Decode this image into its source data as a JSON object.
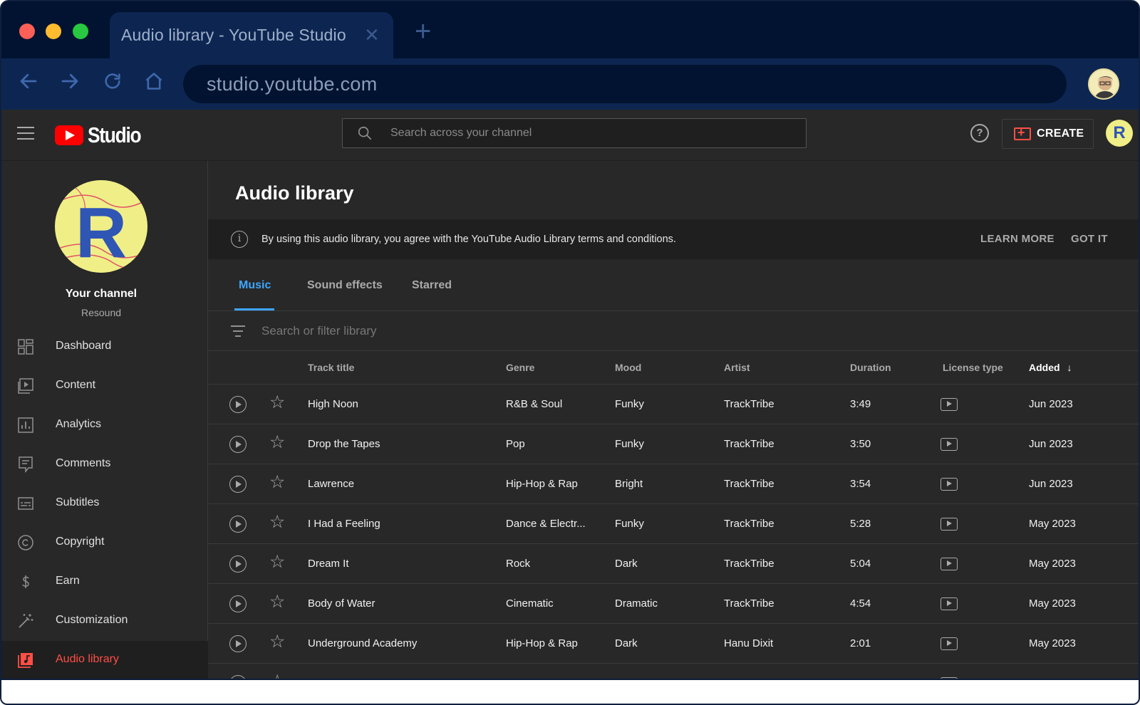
{
  "browser": {
    "tab_title": "Audio library - YouTube Studio",
    "url": "studio.youtube.com"
  },
  "header": {
    "logo_text": "Studio",
    "search_placeholder": "Search across your channel",
    "create_label": "CREATE",
    "avatar_letter": "R"
  },
  "sidebar": {
    "channel_title": "Your channel",
    "channel_name": "Resound",
    "channel_avatar_letter": "R",
    "items": [
      {
        "label": "Dashboard",
        "icon": "dashboard-icon",
        "active": false
      },
      {
        "label": "Content",
        "icon": "content-icon",
        "active": false
      },
      {
        "label": "Analytics",
        "icon": "analytics-icon",
        "active": false
      },
      {
        "label": "Comments",
        "icon": "comments-icon",
        "active": false
      },
      {
        "label": "Subtitles",
        "icon": "subtitles-icon",
        "active": false
      },
      {
        "label": "Copyright",
        "icon": "copyright-icon",
        "active": false
      },
      {
        "label": "Earn",
        "icon": "earn-icon",
        "active": false
      },
      {
        "label": "Customization",
        "icon": "customization-icon",
        "active": false
      },
      {
        "label": "Audio library",
        "icon": "audio-library-icon",
        "active": true
      }
    ]
  },
  "main": {
    "title": "Audio library",
    "banner": {
      "text": "By using this audio library, you agree with the YouTube Audio Library terms and conditions.",
      "learn_more": "LEARN MORE",
      "got_it": "GOT IT"
    },
    "tabs": [
      {
        "label": "Music",
        "active": true
      },
      {
        "label": "Sound effects",
        "active": false
      },
      {
        "label": "Starred",
        "active": false
      }
    ],
    "filter_placeholder": "Search or filter library",
    "columns": {
      "title": "Track title",
      "genre": "Genre",
      "mood": "Mood",
      "artist": "Artist",
      "duration": "Duration",
      "license": "License type",
      "added": "Added"
    },
    "sort_indicator": "↓",
    "tracks": [
      {
        "title": "High Noon",
        "genre": "R&B & Soul",
        "mood": "Funky",
        "artist": "TrackTribe",
        "duration": "3:49",
        "added": "Jun 2023"
      },
      {
        "title": "Drop the Tapes",
        "genre": "Pop",
        "mood": "Funky",
        "artist": "TrackTribe",
        "duration": "3:50",
        "added": "Jun 2023"
      },
      {
        "title": "Lawrence",
        "genre": "Hip-Hop & Rap",
        "mood": "Bright",
        "artist": "TrackTribe",
        "duration": "3:54",
        "added": "Jun 2023"
      },
      {
        "title": "I Had a Feeling",
        "genre": "Dance & Electr...",
        "mood": "Funky",
        "artist": "TrackTribe",
        "duration": "5:28",
        "added": "May 2023"
      },
      {
        "title": "Dream It",
        "genre": "Rock",
        "mood": "Dark",
        "artist": "TrackTribe",
        "duration": "5:04",
        "added": "May 2023"
      },
      {
        "title": "Body of Water",
        "genre": "Cinematic",
        "mood": "Dramatic",
        "artist": "TrackTribe",
        "duration": "4:54",
        "added": "May 2023"
      },
      {
        "title": "Underground Academy",
        "genre": "Hip-Hop & Rap",
        "mood": "Dark",
        "artist": "Hanu Dixit",
        "duration": "2:01",
        "added": "May 2023"
      }
    ]
  },
  "colors": {
    "accent_blue": "#3ea6ff",
    "active_red": "#ff4e45",
    "brand_red": "#ff0000",
    "background": "#282828"
  }
}
